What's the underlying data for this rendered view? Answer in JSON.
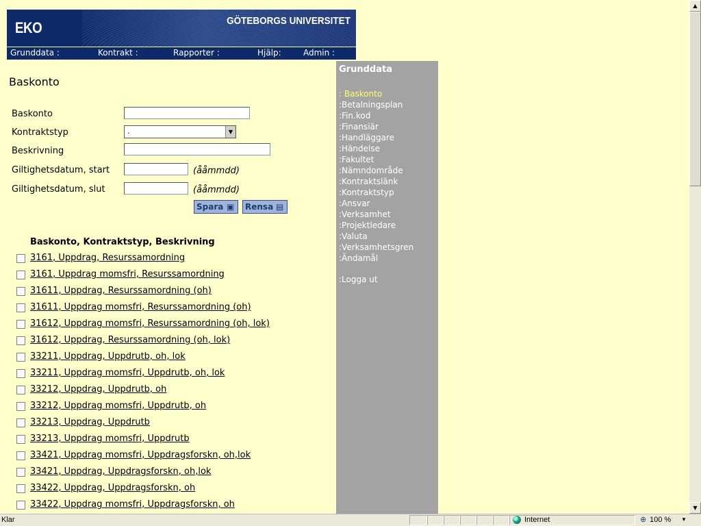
{
  "banner": {
    "logo": "EKO",
    "university": "GÖTEBORGS UNIVERSITET"
  },
  "menu": {
    "grunddata": "Grunddata :",
    "kontrakt": "Kontrakt :",
    "rapporter": "Rapporter :",
    "hjalp": "Hjälp:",
    "admin": "Admin :"
  },
  "page": {
    "title": "Baskonto"
  },
  "form": {
    "baskonto_label": "Baskonto",
    "baskonto_value": "",
    "kontraktstyp_label": "Kontraktstyp",
    "kontraktstyp_value": ".",
    "beskrivning_label": "Beskrivning",
    "beskrivning_value": "",
    "start_label": "Giltighetsdatum, start",
    "start_value": "",
    "start_hint": "(ååmmdd)",
    "slut_label": "Giltighetsdatum, slut",
    "slut_value": "",
    "slut_hint": "(ååmmdd)",
    "spara": "Spara",
    "rensa": "Rensa"
  },
  "list": {
    "header": "Baskonto, Kontraktstyp, Beskrivning",
    "items": [
      "3161, Uppdrag, Resurssamordning",
      "3161, Uppdrag momsfri, Resurssamordning",
      "31611, Uppdrag, Resurssamordning (oh)",
      "31611, Uppdrag momsfri, Resurssamordning (oh)",
      "31612, Uppdrag momsfri, Resurssamordning (oh, lok)",
      "31612, Uppdrag, Resurssamordning (oh, lok)",
      "33211, Uppdrag, Uppdrutb, oh, lok",
      "33211, Uppdrag momsfri, Uppdrutb, oh, lok",
      "33212, Uppdrag, Uppdrutb, oh",
      "33212, Uppdrag momsfri, Uppdrutb, oh",
      "33213, Uppdrag, Uppdrutb",
      "33213, Uppdrag momsfri, Uppdrutb",
      "33421, Uppdrag momsfri, Uppdragsforskn, oh,lok",
      "33421, Uppdrag, Uppdragsforskn, oh,lok",
      "33422, Uppdrag, Uppdragsforskn, oh",
      "33422, Uppdrag momsfri, Uppdragsforskn, oh"
    ]
  },
  "sidebar": {
    "title": "Grunddata",
    "items": [
      ": Baskonto",
      ":Betalningsplan",
      ":Fin.kod",
      ":Finansiär",
      ":Handläggare",
      ":Händelse",
      ":Fakultet",
      ":Nämndområde",
      ":Kontraktslänk",
      ":Kontraktstyp",
      ":Ansvar",
      ":Verksamhet",
      ":Projektledare",
      ":Valuta",
      ":Verksamhetsgren",
      ":Ändamål"
    ],
    "logout": ":Logga ut"
  },
  "statusbar": {
    "status": "Klar",
    "zone": "Internet",
    "zoom": "100 %"
  },
  "colors": {
    "background": "#FFFFCC",
    "banner": "#0E2A6B",
    "sidebar": "#A3A3A3",
    "active_item": "#FFFF66"
  },
  "icons": {
    "save": "save-icon",
    "clear": "document-icon"
  }
}
